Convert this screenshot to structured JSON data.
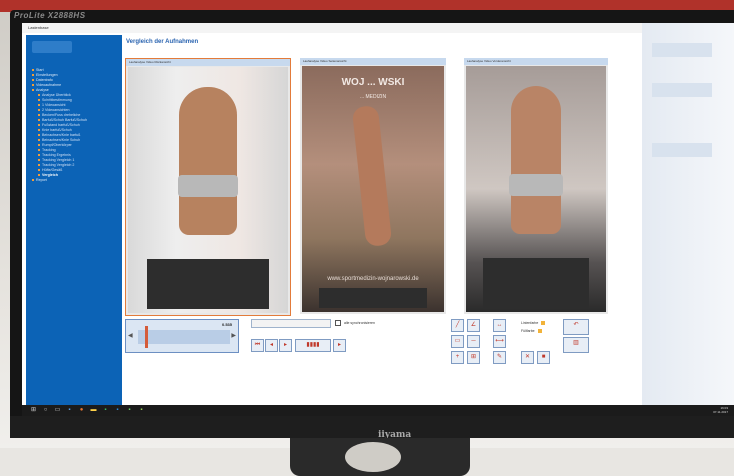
{
  "monitor": {
    "brand_top": "ProLite X2888HS",
    "brand_bottom": "iiyama"
  },
  "window": {
    "title": "Lastenbase",
    "controls": "—  ▢  ✕"
  },
  "sidebar": {
    "items": [
      {
        "label": "Start",
        "level": 0,
        "active": false
      },
      {
        "label": "Einstellungen",
        "level": 0,
        "active": false
      },
      {
        "label": "Datentrafo",
        "level": 0,
        "active": false
      },
      {
        "label": "Videoaufnahme",
        "level": 0,
        "active": false
      },
      {
        "label": "Analyse",
        "level": 0,
        "active": false
      },
      {
        "label": "Analyse Überblick",
        "level": 1,
        "active": false
      },
      {
        "label": "Schrittbestimmung",
        "level": 1,
        "active": false
      },
      {
        "label": "1 Videoansicht",
        "level": 1,
        "active": false
      },
      {
        "label": "2 Videoansichten",
        "level": 1,
        "active": false
      },
      {
        "label": "Becken/Fuss dreheliche",
        "level": 1,
        "active": false
      },
      {
        "label": "Barfuß/Schuh Barfuß/Schuh",
        "level": 1,
        "active": false
      },
      {
        "label": "Fußstand barfuß/Schuh",
        "level": 1,
        "active": false
      },
      {
        "label": "Knie barfuß/Schuh",
        "level": 1,
        "active": false
      },
      {
        "label": "Beinachsen/Knie barfuß",
        "level": 1,
        "active": false
      },
      {
        "label": "Beinachsen/Knie Schuh",
        "level": 1,
        "active": false
      },
      {
        "label": "Rumpf/Oberkörper",
        "level": 1,
        "active": false
      },
      {
        "label": "Tracking",
        "level": 1,
        "active": false
      },
      {
        "label": "Tracking Ergebnis",
        "level": 1,
        "active": false
      },
      {
        "label": "Tracking Vergleich 1",
        "level": 1,
        "active": false
      },
      {
        "label": "Tracking Vergleich 2",
        "level": 1,
        "active": false
      },
      {
        "label": "Hüfte/Gesäß",
        "level": 1,
        "active": false
      },
      {
        "label": "Vergleich",
        "level": 1,
        "active": true
      },
      {
        "label": "Report",
        "level": 0,
        "active": false
      }
    ]
  },
  "main": {
    "title": "Vergleich der Aufnahmen",
    "panels": [
      {
        "header": "Laufanalyse Video Rückansicht"
      },
      {
        "header": "Laufanalyse Video Seitenansicht"
      },
      {
        "header": "Laufanalyse Video Vorderansicht"
      }
    ],
    "poster": {
      "line1": "WOJ ... WSKI",
      "line2": "... MEDIZIN",
      "url": "www.sportmedizin-wojnarowski.de"
    },
    "timeline": {
      "value": "0.535",
      "marker_fraction": 0.08
    },
    "checkbox_label": "alle synchronisieren",
    "legend": {
      "left": "Linienfarbe",
      "right": "Füllfarbe"
    }
  },
  "taskbar": {
    "time": "16:03",
    "date": "07.11.2017"
  },
  "colors": {
    "sidebar": "#0c63b6",
    "accent": "#e37b3a",
    "title": "#2a64b0"
  }
}
